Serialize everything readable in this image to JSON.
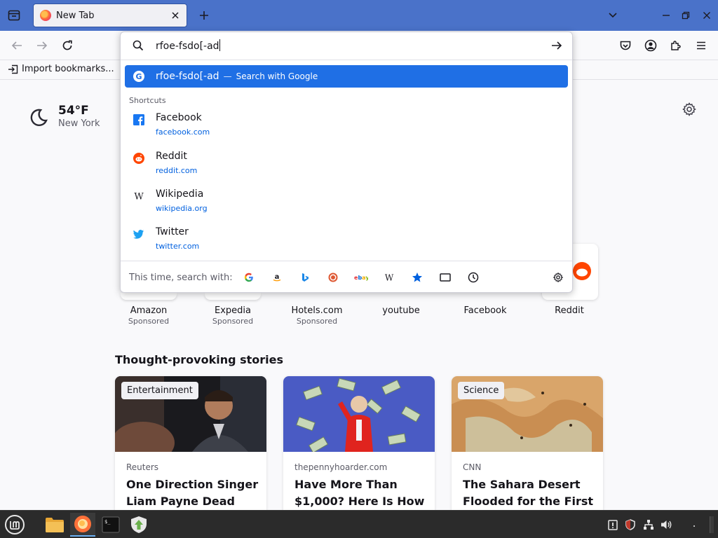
{
  "browser": {
    "tab": {
      "title": "New Tab"
    },
    "bookmarks_bar": {
      "import_label": "Import bookmarks..."
    }
  },
  "urlbar": {
    "value": "rfoe-fsdo[-ad",
    "suggestion": {
      "query": "rfoe-fsdo[-ad",
      "dash": "—",
      "action": "Search with Google"
    },
    "shortcuts_label": "Shortcuts",
    "shortcuts": [
      {
        "name": "Facebook",
        "url": "facebook.com",
        "icon": "facebook-icon"
      },
      {
        "name": "Reddit",
        "url": "reddit.com",
        "icon": "reddit-icon"
      },
      {
        "name": "Wikipedia",
        "url": "wikipedia.org",
        "icon": "wikipedia-icon"
      },
      {
        "name": "Twitter",
        "url": "twitter.com",
        "icon": "twitter-icon"
      }
    ],
    "search_with_label": "This time, search with:",
    "engines": [
      "Google",
      "Amazon",
      "Bing",
      "DuckDuckGo",
      "eBay",
      "Wikipedia",
      "Bookmarks",
      "Tabs",
      "History"
    ]
  },
  "weather": {
    "temp": "54°F",
    "city": "New York"
  },
  "top_sites": [
    {
      "name": "Amazon",
      "sponsored": "Sponsored"
    },
    {
      "name": "Expedia",
      "sponsored": "Sponsored"
    },
    {
      "name": "Hotels.com",
      "sponsored": "Sponsored"
    },
    {
      "name": "youtube",
      "sponsored": ""
    },
    {
      "name": "Facebook",
      "sponsored": ""
    },
    {
      "name": "Reddit",
      "sponsored": ""
    }
  ],
  "stories": {
    "title": "Thought-provoking stories",
    "cards": [
      {
        "badge": "Entertainment",
        "source": "Reuters",
        "headline": "One Direction Singer Liam Payne Dead After"
      },
      {
        "badge": "",
        "source": "thepennyhoarder.com",
        "headline": "Have More Than $1,000? Here Is How"
      },
      {
        "badge": "Science",
        "source": "CNN",
        "headline": "The Sahara Desert Flooded for the First"
      }
    ]
  },
  "colors": {
    "tabstrip": "#4a72c9",
    "highlight": "#1f6fe5",
    "link": "#0060df",
    "taskbar": "#2b2b2b"
  }
}
